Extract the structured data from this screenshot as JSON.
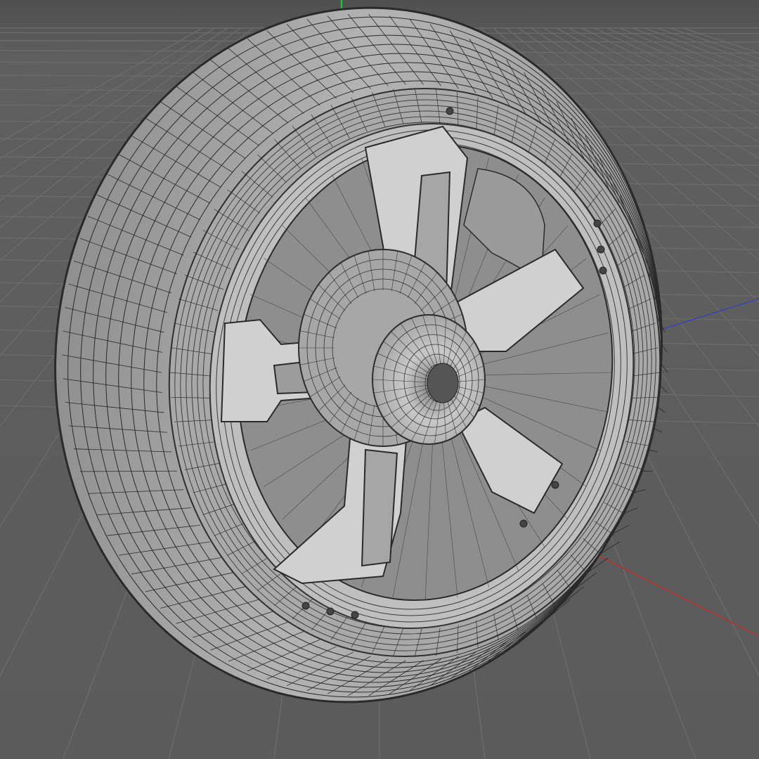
{
  "viewport": {
    "mode": "wireframe-shaded",
    "background_color": "#5d5d5d",
    "grid_color": "#6c6c6c",
    "axis_x_color": "#b83232",
    "axis_y_color": "#2cb83c",
    "axis_z_color": "#3846b4"
  },
  "model": {
    "object": "wheel",
    "wire_color": "#2a2a2a",
    "tire_color": "#a8a8a8",
    "rim_color": "#b9b9b9",
    "spoke_color": "#d0d0d0",
    "hub_color": "#bdbdbd"
  }
}
